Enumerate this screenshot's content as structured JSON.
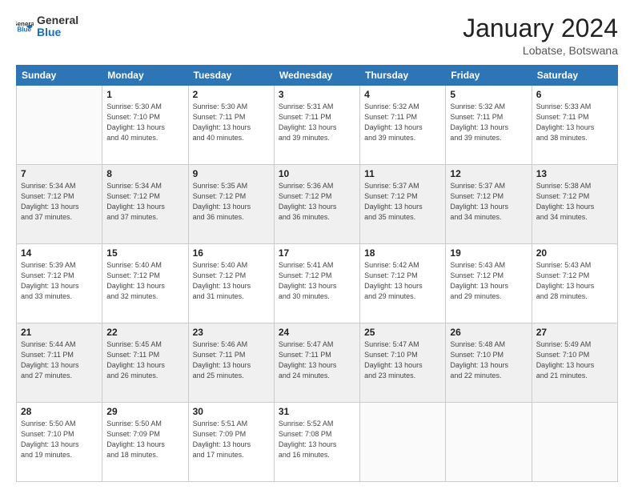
{
  "header": {
    "logo_general": "General",
    "logo_blue": "Blue",
    "month_title": "January 2024",
    "subtitle": "Lobatse, Botswana"
  },
  "days_of_week": [
    "Sunday",
    "Monday",
    "Tuesday",
    "Wednesday",
    "Thursday",
    "Friday",
    "Saturday"
  ],
  "weeks": [
    [
      {
        "day": "",
        "info": ""
      },
      {
        "day": "1",
        "info": "Sunrise: 5:30 AM\nSunset: 7:10 PM\nDaylight: 13 hours\nand 40 minutes."
      },
      {
        "day": "2",
        "info": "Sunrise: 5:30 AM\nSunset: 7:11 PM\nDaylight: 13 hours\nand 40 minutes."
      },
      {
        "day": "3",
        "info": "Sunrise: 5:31 AM\nSunset: 7:11 PM\nDaylight: 13 hours\nand 39 minutes."
      },
      {
        "day": "4",
        "info": "Sunrise: 5:32 AM\nSunset: 7:11 PM\nDaylight: 13 hours\nand 39 minutes."
      },
      {
        "day": "5",
        "info": "Sunrise: 5:32 AM\nSunset: 7:11 PM\nDaylight: 13 hours\nand 39 minutes."
      },
      {
        "day": "6",
        "info": "Sunrise: 5:33 AM\nSunset: 7:11 PM\nDaylight: 13 hours\nand 38 minutes."
      }
    ],
    [
      {
        "day": "7",
        "info": "Sunrise: 5:34 AM\nSunset: 7:12 PM\nDaylight: 13 hours\nand 37 minutes."
      },
      {
        "day": "8",
        "info": "Sunrise: 5:34 AM\nSunset: 7:12 PM\nDaylight: 13 hours\nand 37 minutes."
      },
      {
        "day": "9",
        "info": "Sunrise: 5:35 AM\nSunset: 7:12 PM\nDaylight: 13 hours\nand 36 minutes."
      },
      {
        "day": "10",
        "info": "Sunrise: 5:36 AM\nSunset: 7:12 PM\nDaylight: 13 hours\nand 36 minutes."
      },
      {
        "day": "11",
        "info": "Sunrise: 5:37 AM\nSunset: 7:12 PM\nDaylight: 13 hours\nand 35 minutes."
      },
      {
        "day": "12",
        "info": "Sunrise: 5:37 AM\nSunset: 7:12 PM\nDaylight: 13 hours\nand 34 minutes."
      },
      {
        "day": "13",
        "info": "Sunrise: 5:38 AM\nSunset: 7:12 PM\nDaylight: 13 hours\nand 34 minutes."
      }
    ],
    [
      {
        "day": "14",
        "info": "Sunrise: 5:39 AM\nSunset: 7:12 PM\nDaylight: 13 hours\nand 33 minutes."
      },
      {
        "day": "15",
        "info": "Sunrise: 5:40 AM\nSunset: 7:12 PM\nDaylight: 13 hours\nand 32 minutes."
      },
      {
        "day": "16",
        "info": "Sunrise: 5:40 AM\nSunset: 7:12 PM\nDaylight: 13 hours\nand 31 minutes."
      },
      {
        "day": "17",
        "info": "Sunrise: 5:41 AM\nSunset: 7:12 PM\nDaylight: 13 hours\nand 30 minutes."
      },
      {
        "day": "18",
        "info": "Sunrise: 5:42 AM\nSunset: 7:12 PM\nDaylight: 13 hours\nand 29 minutes."
      },
      {
        "day": "19",
        "info": "Sunrise: 5:43 AM\nSunset: 7:12 PM\nDaylight: 13 hours\nand 29 minutes."
      },
      {
        "day": "20",
        "info": "Sunrise: 5:43 AM\nSunset: 7:12 PM\nDaylight: 13 hours\nand 28 minutes."
      }
    ],
    [
      {
        "day": "21",
        "info": "Sunrise: 5:44 AM\nSunset: 7:11 PM\nDaylight: 13 hours\nand 27 minutes."
      },
      {
        "day": "22",
        "info": "Sunrise: 5:45 AM\nSunset: 7:11 PM\nDaylight: 13 hours\nand 26 minutes."
      },
      {
        "day": "23",
        "info": "Sunrise: 5:46 AM\nSunset: 7:11 PM\nDaylight: 13 hours\nand 25 minutes."
      },
      {
        "day": "24",
        "info": "Sunrise: 5:47 AM\nSunset: 7:11 PM\nDaylight: 13 hours\nand 24 minutes."
      },
      {
        "day": "25",
        "info": "Sunrise: 5:47 AM\nSunset: 7:10 PM\nDaylight: 13 hours\nand 23 minutes."
      },
      {
        "day": "26",
        "info": "Sunrise: 5:48 AM\nSunset: 7:10 PM\nDaylight: 13 hours\nand 22 minutes."
      },
      {
        "day": "27",
        "info": "Sunrise: 5:49 AM\nSunset: 7:10 PM\nDaylight: 13 hours\nand 21 minutes."
      }
    ],
    [
      {
        "day": "28",
        "info": "Sunrise: 5:50 AM\nSunset: 7:10 PM\nDaylight: 13 hours\nand 19 minutes."
      },
      {
        "day": "29",
        "info": "Sunrise: 5:50 AM\nSunset: 7:09 PM\nDaylight: 13 hours\nand 18 minutes."
      },
      {
        "day": "30",
        "info": "Sunrise: 5:51 AM\nSunset: 7:09 PM\nDaylight: 13 hours\nand 17 minutes."
      },
      {
        "day": "31",
        "info": "Sunrise: 5:52 AM\nSunset: 7:08 PM\nDaylight: 13 hours\nand 16 minutes."
      },
      {
        "day": "",
        "info": ""
      },
      {
        "day": "",
        "info": ""
      },
      {
        "day": "",
        "info": ""
      }
    ]
  ]
}
